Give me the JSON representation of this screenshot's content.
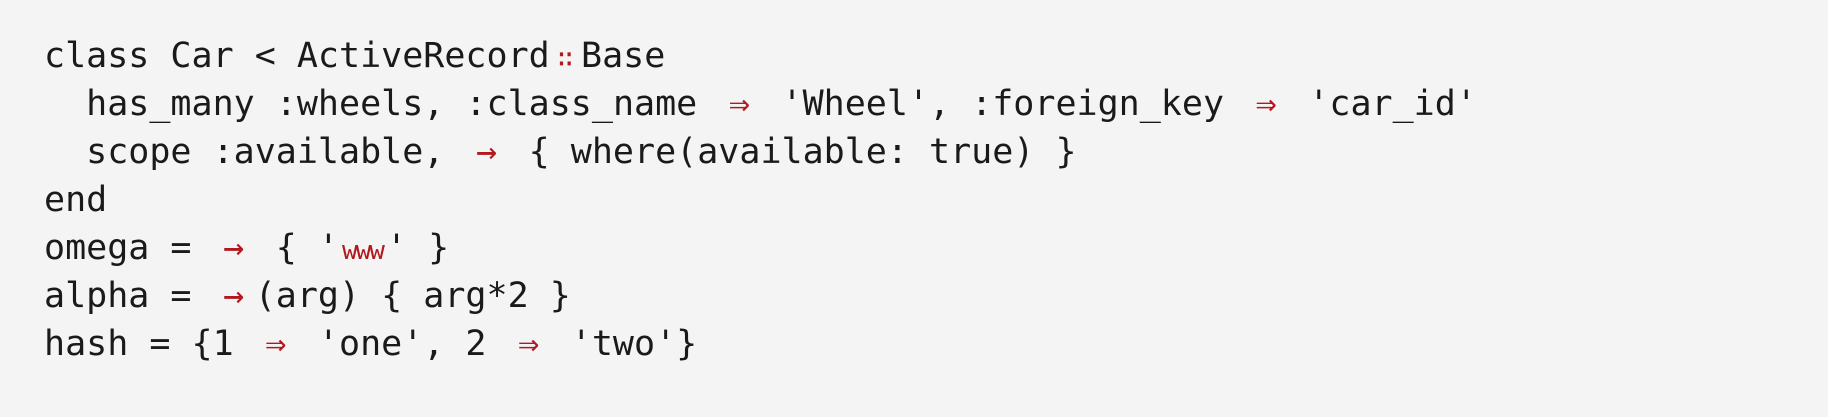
{
  "colors": {
    "background": "#f4f4f4",
    "text": "#1a1a1a",
    "ligature": "#b2191f"
  },
  "code": {
    "l1": {
      "a": "class Car < ActiveRecord",
      "op": "::",
      "b": "Base"
    },
    "l2": {
      "a": "  has_many :wheels, :class_name ",
      "op1": "=>",
      "b": " 'Wheel', :foreign_key ",
      "op2": "=>",
      "c": " 'car_id'"
    },
    "l3": {
      "a": "  scope :available, ",
      "op": "->",
      "b": " { where(available: true) }"
    },
    "l4": {
      "a": "end"
    },
    "l5": {
      "a": "omega = ",
      "op": "->",
      "b": " { '",
      "www": "www",
      "c": "' }"
    },
    "l6": {
      "a": "alpha = ",
      "op": "->",
      "b": "(arg) { arg*2 }"
    },
    "l7": {
      "a": "hash = {1 ",
      "op1": "=>",
      "b": " 'one', 2 ",
      "op2": "=>",
      "c": " 'two'}"
    }
  }
}
